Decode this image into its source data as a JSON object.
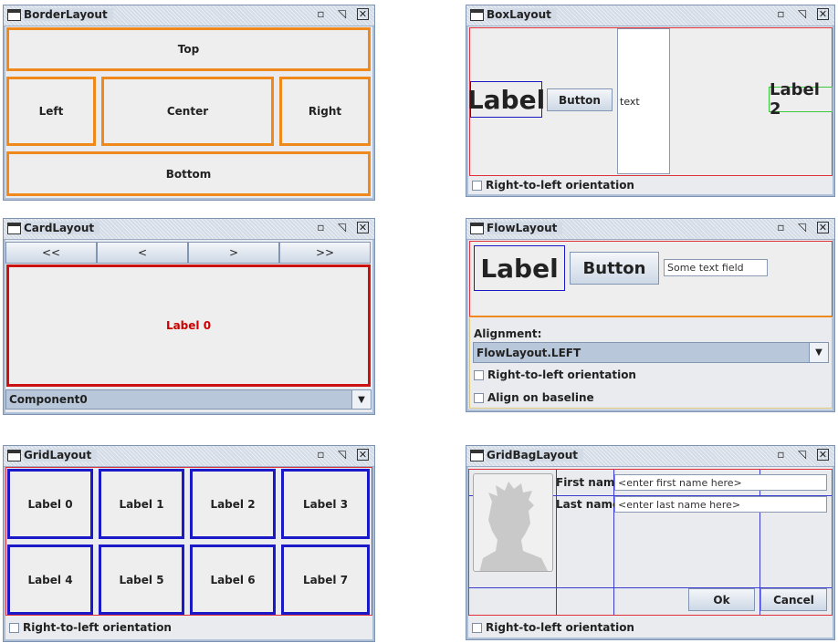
{
  "windows": {
    "border": {
      "title": "BorderLayout",
      "regions": {
        "top": "Top",
        "left": "Left",
        "center": "Center",
        "right": "Right",
        "bottom": "Bottom"
      }
    },
    "box": {
      "title": "BoxLayout",
      "label": "Label",
      "button": "Button",
      "text": "text",
      "label2": "Label 2",
      "rtl": "Right-to-left orientation"
    },
    "card": {
      "title": "CardLayout",
      "nav": [
        "<<",
        "<",
        ">",
        ">>"
      ],
      "label": "Label 0",
      "combo_value": "Component0"
    },
    "flow": {
      "title": "FlowLayout",
      "label": "Label",
      "button": "Button",
      "textfield": "Some text field",
      "alignment_label": "Alignment:",
      "alignment_value": "FlowLayout.LEFT",
      "rtl": "Right-to-left orientation",
      "baseline": "Align on baseline"
    },
    "grid": {
      "title": "GridLayout",
      "labels": [
        "Label 0",
        "Label 1",
        "Label 2",
        "Label 3",
        "Label 4",
        "Label 5",
        "Label 6",
        "Label 7"
      ],
      "rtl": "Right-to-left orientation"
    },
    "gridbag": {
      "title": "GridBagLayout",
      "first_name_label": "First name:",
      "first_name_placeholder": "<enter first name here>",
      "last_name_label": "Last name:",
      "last_name_placeholder": "<enter last name here>",
      "ok": "Ok",
      "cancel": "Cancel",
      "rtl": "Right-to-left orientation"
    }
  },
  "titlebar_icons": [
    "window-icon",
    "minimize-icon",
    "maximize-icon",
    "close-icon"
  ],
  "colors": {
    "orange_border": "#f0891c",
    "blue_border": "#1919c8",
    "red_border": "#e0303a",
    "green_border": "#3cc83c",
    "card_label": "#cc0000"
  }
}
